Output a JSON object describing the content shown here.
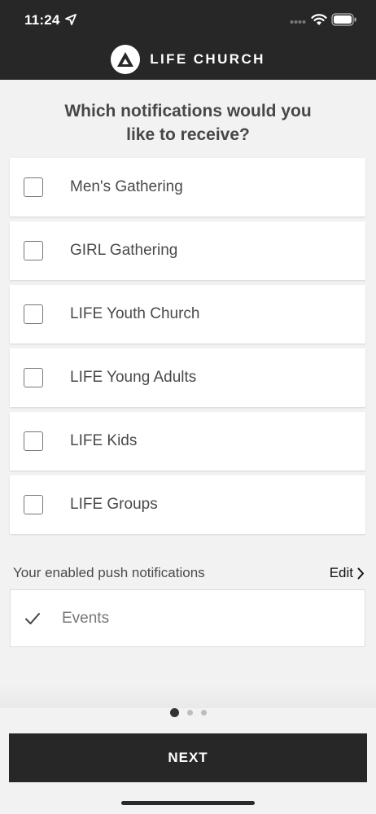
{
  "status_bar": {
    "time": "11:24"
  },
  "header": {
    "brand": "LIFE CHURCH"
  },
  "question": "Which notifications would you like to receive?",
  "options": [
    {
      "label": "Men's Gathering",
      "checked": false
    },
    {
      "label": "GIRL Gathering",
      "checked": false
    },
    {
      "label": "LIFE Youth Church",
      "checked": false
    },
    {
      "label": "LIFE Young Adults",
      "checked": false
    },
    {
      "label": "LIFE Kids",
      "checked": false
    },
    {
      "label": "LIFE Groups",
      "checked": false
    }
  ],
  "enabled": {
    "title": "Your enabled push notifications",
    "edit_label": "Edit",
    "items": [
      {
        "label": "Events"
      }
    ]
  },
  "pagination": {
    "current": 1,
    "total": 3
  },
  "next_label": "NEXT",
  "colors": {
    "header_bg": "#272727",
    "page_bg": "#f2f2f2",
    "button_bg": "#272727"
  }
}
